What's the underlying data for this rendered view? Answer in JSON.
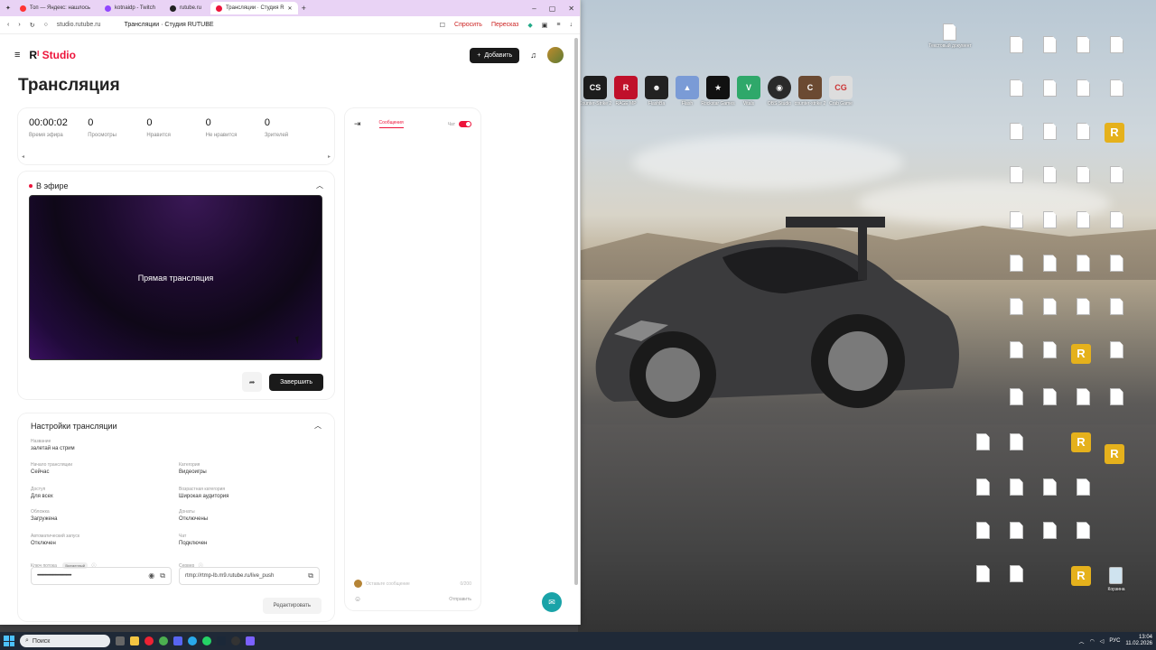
{
  "browser": {
    "tabs": [
      {
        "label": "Топ — Яндекс: нашлось",
        "color": "#f33",
        "active": false
      },
      {
        "label": "kotnaidp - Twitch",
        "color": "#9146ff",
        "active": false
      },
      {
        "label": "rutube.ru",
        "color": "#222",
        "active": false
      },
      {
        "label": "Трансляции · Студия R",
        "color": "#ed143b",
        "active": true
      }
    ],
    "url": "studio.rutube.ru",
    "page_title": "Трансляции · Студия RUTUBE",
    "addr_actions": [
      "Спросить",
      "Пересказ"
    ]
  },
  "header": {
    "logo_prefix": "R",
    "logo_brand": "Studio",
    "add_label": "Добавить"
  },
  "page": {
    "title": "Трансляция"
  },
  "stats": [
    {
      "value": "00:00:02",
      "label": "Время эфира"
    },
    {
      "value": "0",
      "label": "Просмотры"
    },
    {
      "value": "0",
      "label": "Нравится"
    },
    {
      "value": "0",
      "label": "Не нравится"
    },
    {
      "value": "0",
      "label": "Зрителей"
    }
  ],
  "live": {
    "status": "В эфире",
    "player_text": "Прямая трансляция",
    "end_label": "Завершить"
  },
  "settings": {
    "title": "Настройки трансляции",
    "fields": {
      "name": {
        "label": "Название",
        "value": "залетай на стрим"
      },
      "start": {
        "label": "Начало трансляции",
        "value": "Сейчас"
      },
      "category": {
        "label": "Категория",
        "value": "Видеоигры"
      },
      "access": {
        "label": "Доступ",
        "value": "Для всех"
      },
      "age": {
        "label": "Возрастная категория",
        "value": "Широкая аудитория"
      },
      "cover": {
        "label": "Обложка",
        "value": "Загружена"
      },
      "donate": {
        "label": "Донаты",
        "value": "Отключены"
      },
      "autostart": {
        "label": "Автоматический запуск",
        "value": "Отключен"
      },
      "chat": {
        "label": "Чат",
        "value": "Подключен"
      },
      "key": {
        "label": "Ключ потока",
        "badge": "Временный",
        "value": "••••••••••••••••••••••••••••••••••"
      },
      "server": {
        "label": "Сервер",
        "value": "rtmp://rtmp-lb.m9.rutube.ru/live_push"
      }
    },
    "edit_label": "Редактировать"
  },
  "chat": {
    "tab_label": "Сообщения",
    "chat_label": "Чат",
    "input_placeholder": "Оставьте сообщение",
    "counter": "0/200",
    "send_label": "Отправить"
  },
  "desktop": {
    "apps": [
      {
        "label": "Counter-Strike 2",
        "color": "#1d1d1d"
      },
      {
        "label": "RAGE MP",
        "color": "#c0102a"
      },
      {
        "label": "FlashBa",
        "color": "#222"
      },
      {
        "label": "Flash",
        "color": "#7a9bd6"
      },
      {
        "label": "Rockstar Games",
        "color": "#111"
      },
      {
        "label": "Vitals",
        "color": "#2fa86a"
      },
      {
        "label": "OBS Studio",
        "color": "#2a2a2a"
      },
      {
        "label": "counter-strike 2",
        "color": "#6b4a32"
      },
      {
        "label": "Crab Game",
        "color": "#ddd"
      }
    ],
    "top_file": "Текстовый документ",
    "trash_label": "Корзина"
  },
  "taskbar": {
    "search": "Поиск",
    "lang": "РУС",
    "time": "13:04",
    "date": "11.02.2026"
  }
}
